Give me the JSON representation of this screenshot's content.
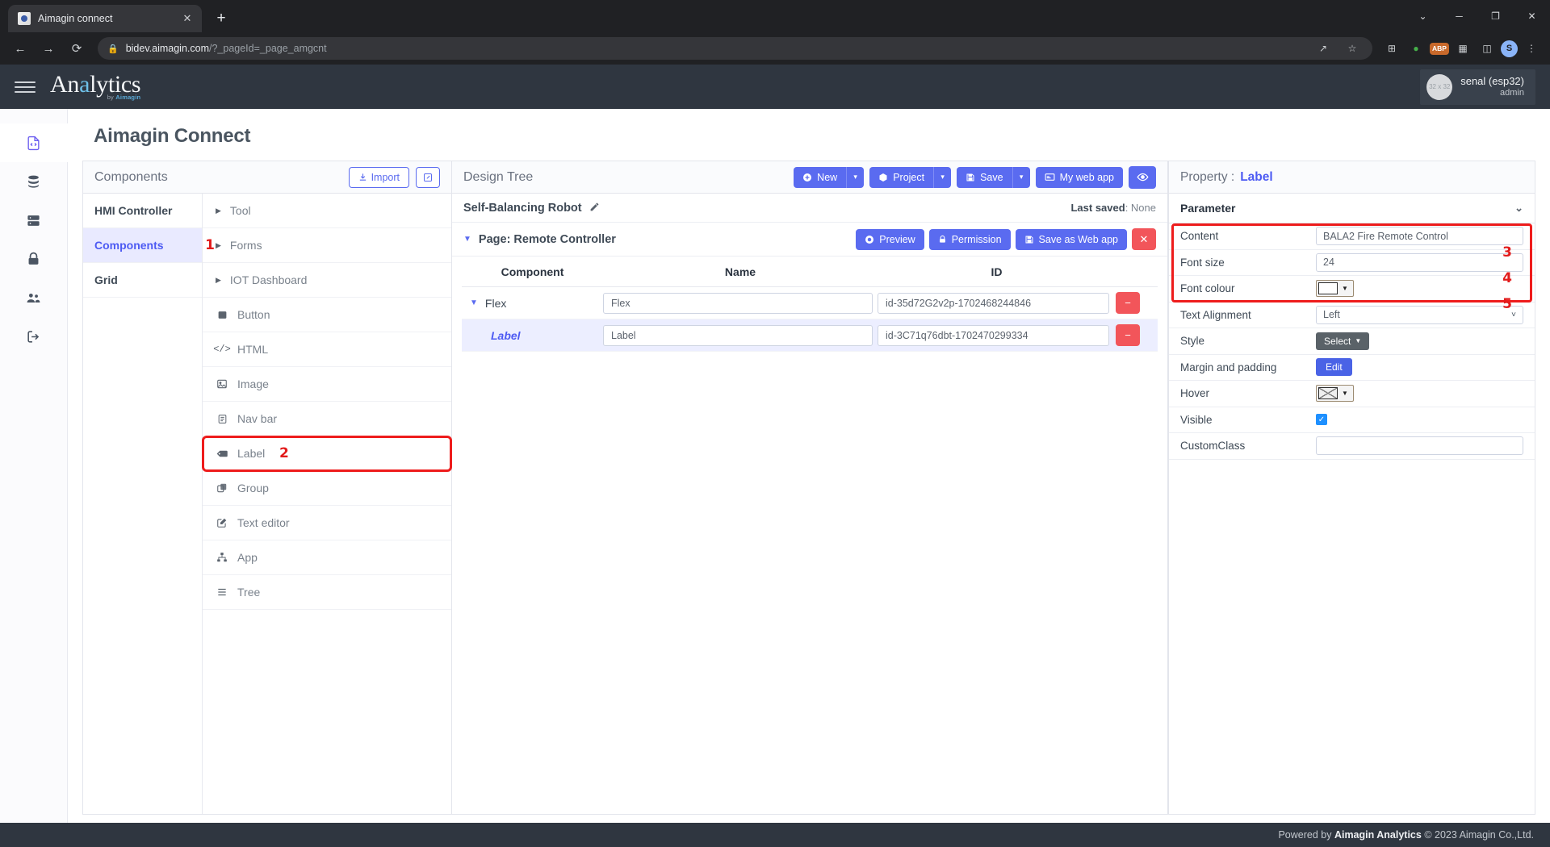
{
  "browser": {
    "tab_title": "Aimagin connect",
    "tab_close": "✕",
    "new_tab": "+",
    "url_main": "bidev.aimagin.com",
    "url_rest": "/?_pageId=_page_amgcnt",
    "lock_icon": "lock-icon",
    "nav_back": "←",
    "nav_forward": "→",
    "reload": "⟳",
    "share_icon": "↗",
    "star_icon": "☆",
    "translate_icon": "⊞",
    "ext_icon": "🧩",
    "abp_label": "ABP",
    "profile_initial": "S",
    "menu_icon": "⋮",
    "win_minimize": "─",
    "win_maximize": "❐",
    "win_close": "✕",
    "win_chevron": "⌄"
  },
  "header": {
    "brand_part1": "An",
    "brand_accent": "a",
    "brand_part2": "lytics",
    "brand_sub_pre": "by ",
    "brand_sub_name": "Aimagin",
    "user_name": "senal (esp32)",
    "user_role": "admin",
    "avatar_text": "32 x 32"
  },
  "rail": {
    "items": [
      {
        "name": "file-code-icon",
        "active": true
      },
      {
        "name": "database-icon",
        "active": false
      },
      {
        "name": "server-icon",
        "active": false
      },
      {
        "name": "lock-icon",
        "active": false
      },
      {
        "name": "users-icon",
        "active": false
      },
      {
        "name": "logout-icon",
        "active": false
      }
    ]
  },
  "page": {
    "title": "Aimagin Connect"
  },
  "components_panel": {
    "title": "Components",
    "import_label": "Import",
    "import_icon": "download-icon",
    "edit_icon": "pencil-square-icon",
    "categories": [
      {
        "label": "HMI Controller",
        "active": false,
        "marker": ""
      },
      {
        "label": "Components",
        "active": true,
        "marker": "1"
      },
      {
        "label": "Grid",
        "active": false,
        "marker": ""
      }
    ],
    "items": [
      {
        "label": "Tool",
        "icon": "caret-right-icon",
        "group": true,
        "highlight": false,
        "marker": ""
      },
      {
        "label": "Forms",
        "icon": "caret-right-icon",
        "group": true,
        "highlight": false,
        "marker": ""
      },
      {
        "label": "IOT Dashboard",
        "icon": "caret-right-icon",
        "group": true,
        "highlight": false,
        "marker": ""
      },
      {
        "label": "Button",
        "icon": "square-icon",
        "group": false,
        "highlight": false,
        "marker": ""
      },
      {
        "label": "HTML",
        "icon": "code-icon",
        "group": false,
        "highlight": false,
        "marker": ""
      },
      {
        "label": "Image",
        "icon": "image-icon",
        "group": false,
        "highlight": false,
        "marker": ""
      },
      {
        "label": "Nav bar",
        "icon": "navbar-icon",
        "group": false,
        "highlight": false,
        "marker": ""
      },
      {
        "label": "Label",
        "icon": "tag-icon",
        "group": false,
        "highlight": true,
        "marker": "2"
      },
      {
        "label": "Group",
        "icon": "copy-icon",
        "group": false,
        "highlight": false,
        "marker": ""
      },
      {
        "label": "Text editor",
        "icon": "pencil-square-icon",
        "group": false,
        "highlight": false,
        "marker": ""
      },
      {
        "label": "App",
        "icon": "sitemap-icon",
        "group": false,
        "highlight": false,
        "marker": ""
      },
      {
        "label": "Tree",
        "icon": "list-icon",
        "group": false,
        "highlight": false,
        "marker": ""
      }
    ]
  },
  "design_tree": {
    "title": "Design Tree",
    "toolbar": {
      "new_label": "New",
      "new_icon": "plus-circle-icon",
      "project_label": "Project",
      "project_icon": "cube-icon",
      "save_label": "Save",
      "save_icon": "floppy-icon",
      "mywebapp_label": "My web app",
      "mywebapp_icon": "window-icon",
      "eye_icon": "eye-icon",
      "caret": "▾"
    },
    "project_name": "Self-Balancing Robot",
    "pencil_icon": "pencil-icon",
    "last_saved_label": "Last saved",
    "last_saved_value": "None",
    "page_label": "Page: Remote Controller",
    "page_actions": {
      "preview_label": "Preview",
      "preview_icon": "eye-circle-icon",
      "permission_label": "Permission",
      "permission_icon": "lock-icon",
      "save_web_label": "Save as Web app",
      "save_web_icon": "floppy-icon",
      "close_label": "✕"
    },
    "columns": {
      "component": "Component",
      "name": "Name",
      "id": "ID"
    },
    "rows": [
      {
        "component": "Flex",
        "name_value": "Flex",
        "id_value": "id-35d72G2v2p-1702468244846",
        "indent": false,
        "selected": false,
        "remove_label": "−",
        "expander": "▾"
      },
      {
        "component": "Label",
        "name_value": "Label",
        "id_value": "id-3C71q76dbt-1702470299334",
        "indent": true,
        "selected": true,
        "remove_label": "−",
        "expander": ""
      }
    ]
  },
  "property_panel": {
    "title_label": "Property :",
    "title_value": "Label",
    "section_label": "Parameter",
    "section_chevron": "⌄",
    "rows": [
      {
        "label": "Content",
        "type": "input",
        "value": "BALA2 Fire Remote Control",
        "marker": "3"
      },
      {
        "label": "Font size",
        "type": "input",
        "value": "24",
        "marker": "4"
      },
      {
        "label": "Font colour",
        "type": "color",
        "value": "#ffffff",
        "marker": "5"
      },
      {
        "label": "Text Alignment",
        "type": "select",
        "value": "Left",
        "marker": ""
      },
      {
        "label": "Style",
        "type": "button-grey",
        "value": "Select",
        "marker": ""
      },
      {
        "label": "Margin and padding",
        "type": "button-blue",
        "value": "Edit",
        "marker": ""
      },
      {
        "label": "Hover",
        "type": "color-hatch",
        "value": "",
        "marker": ""
      },
      {
        "label": "Visible",
        "type": "checkbox",
        "value": "✓",
        "marker": ""
      },
      {
        "label": "CustomClass",
        "type": "input",
        "value": "",
        "marker": ""
      }
    ]
  },
  "footer": {
    "pre": "Powered by ",
    "brand": "Aimagin Analytics",
    "post": " © 2023 Aimagin Co.,Ltd."
  },
  "colors": {
    "primary": "#5a6bf0",
    "danger": "#f2555a",
    "marker_red": "#ee1c1c",
    "header_dark": "#2f3640",
    "accent_blue": "#4d5bf3"
  }
}
